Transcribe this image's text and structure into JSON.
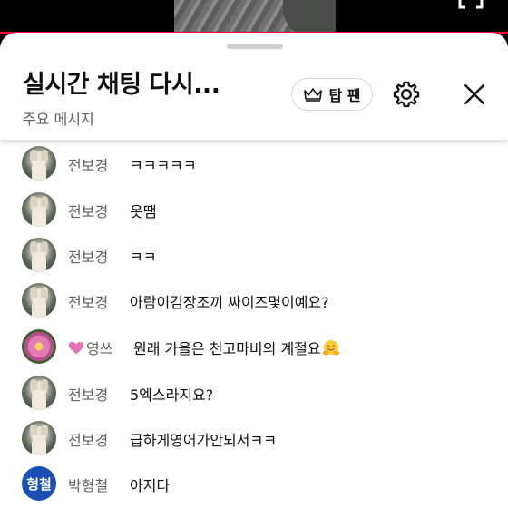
{
  "header": {
    "title": "실시간 채팅 다시...",
    "subtitle": "주요 메시지",
    "top_fan_label": "탑 팬"
  },
  "video": {
    "progress_percent": 100,
    "progress_color": "#ff0033"
  },
  "messages": [
    {
      "author": "전보경",
      "text": "ㅋㅋㅋㅋㅋ",
      "avatar": "dog"
    },
    {
      "author": "전보경",
      "text": "옷땜",
      "avatar": "dog"
    },
    {
      "author": "전보경",
      "text": "ㅋㅋ",
      "avatar": "dog"
    },
    {
      "author": "전보경",
      "text": "아람이김장조끼 싸이즈몇이예요?",
      "avatar": "dog"
    },
    {
      "author": "영쓰",
      "text": "원래 가을은 천고마비의 계절요",
      "avatar": "flower",
      "author_prefix_emoji": "sparkling-heart",
      "text_suffix_emoji": "hugging-face"
    },
    {
      "author": "전보경",
      "text": "5엑스라지요?",
      "avatar": "dog"
    },
    {
      "author": "전보경",
      "text": "급하게영어가안되서ㅋㅋ",
      "avatar": "dog"
    },
    {
      "author": "박형철",
      "text": "아지다",
      "avatar": "initials",
      "avatar_initials": "형철",
      "avatar_color": "#1b4fb3"
    }
  ],
  "icons": {
    "crown": "crown-icon",
    "settings": "gear-icon",
    "close": "close-icon",
    "fullscreen": "fullscreen-icon"
  }
}
